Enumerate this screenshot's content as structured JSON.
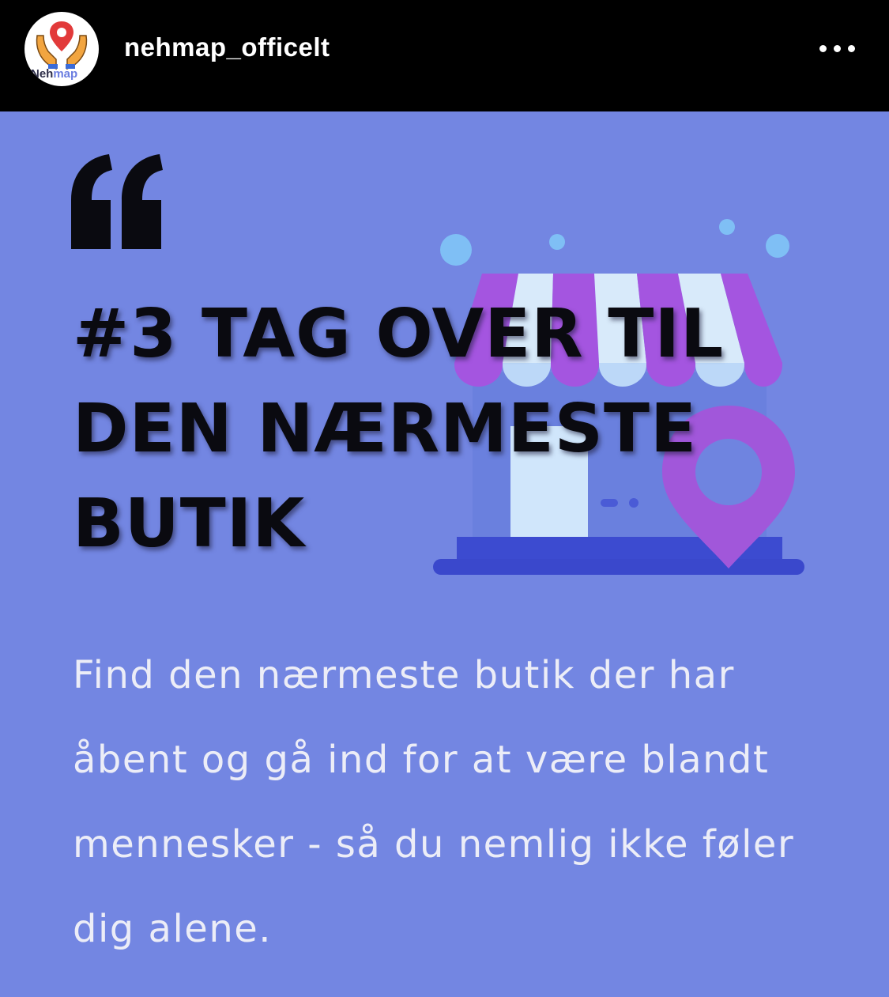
{
  "header": {
    "username": "nehmap_officelt",
    "avatar": {
      "logo_text_part1": "Neh",
      "logo_text_part2": "map",
      "icon": "hands-holding-map-pin-icon"
    },
    "more_icon": "more-horizontal-icon"
  },
  "post": {
    "background_color": "#7386e2",
    "quote_icon": "quote-mark-icon",
    "title_lines": [
      "#3 TAG OVER TIL",
      "DEN NÆRMESTE",
      "BUTIK"
    ],
    "body": "Find den nærmeste butik der har åbent og gå ind for at være blandt mennesker - så du nemlig ikke føler dig alene.",
    "illustration": {
      "icons": [
        "store-icon",
        "map-pin-icon"
      ],
      "colors": {
        "awning_purple": "#a455e0",
        "awning_light": "#d8eafa",
        "pin": "#a157da",
        "ground": "#3c4bd0",
        "bubble": "#7fbff5"
      }
    }
  }
}
